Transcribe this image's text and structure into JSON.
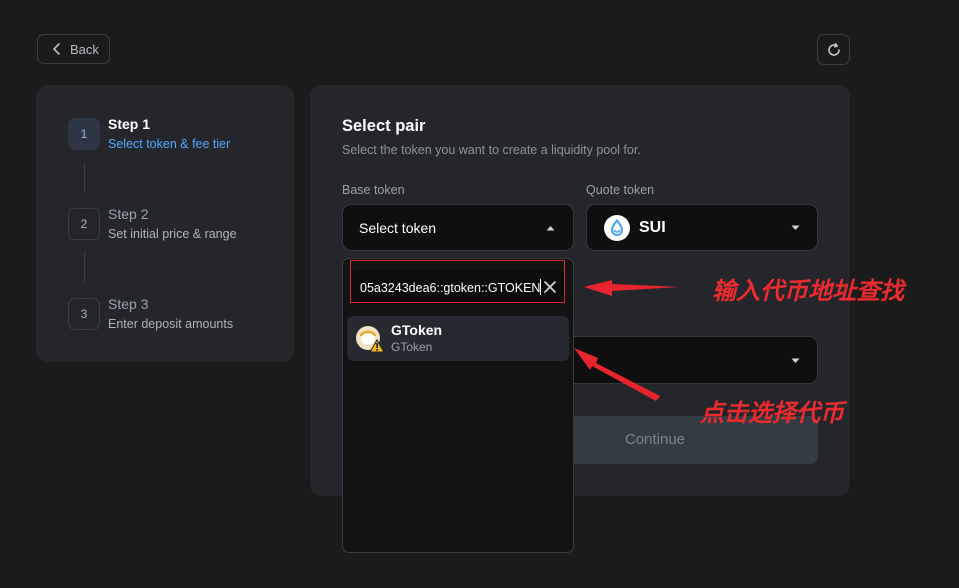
{
  "header": {
    "back_label": "Back"
  },
  "steps": [
    {
      "number": "1",
      "title": "Step  1",
      "subtitle": "Select token & fee tier",
      "active": true
    },
    {
      "number": "2",
      "title": "Step  2",
      "subtitle": "Set initial price & range",
      "active": false
    },
    {
      "number": "3",
      "title": "Step  3",
      "subtitle": "Enter deposit amounts",
      "active": false
    }
  ],
  "main": {
    "title": "Select pair",
    "subtitle": "Select the token you want to create a liquidity pool for.",
    "base_label": "Base token",
    "base_value": "Select token",
    "quote_label": "Quote token",
    "quote_value": "SUI",
    "continue_label": "Continue"
  },
  "dropdown": {
    "search_value": "05a3243dea6::gtoken::GTOKEN",
    "results": [
      {
        "name": "GToken",
        "symbol": "GToken"
      }
    ]
  },
  "annotations": {
    "search_note": "输入代币地址查找",
    "select_note": "点击选择代币"
  },
  "colors": {
    "accent_blue": "#52a9ff",
    "annotation_red": "#ec2b2f",
    "sui_blue": "#4da2ff",
    "warning_yellow": "#f2b51f"
  }
}
